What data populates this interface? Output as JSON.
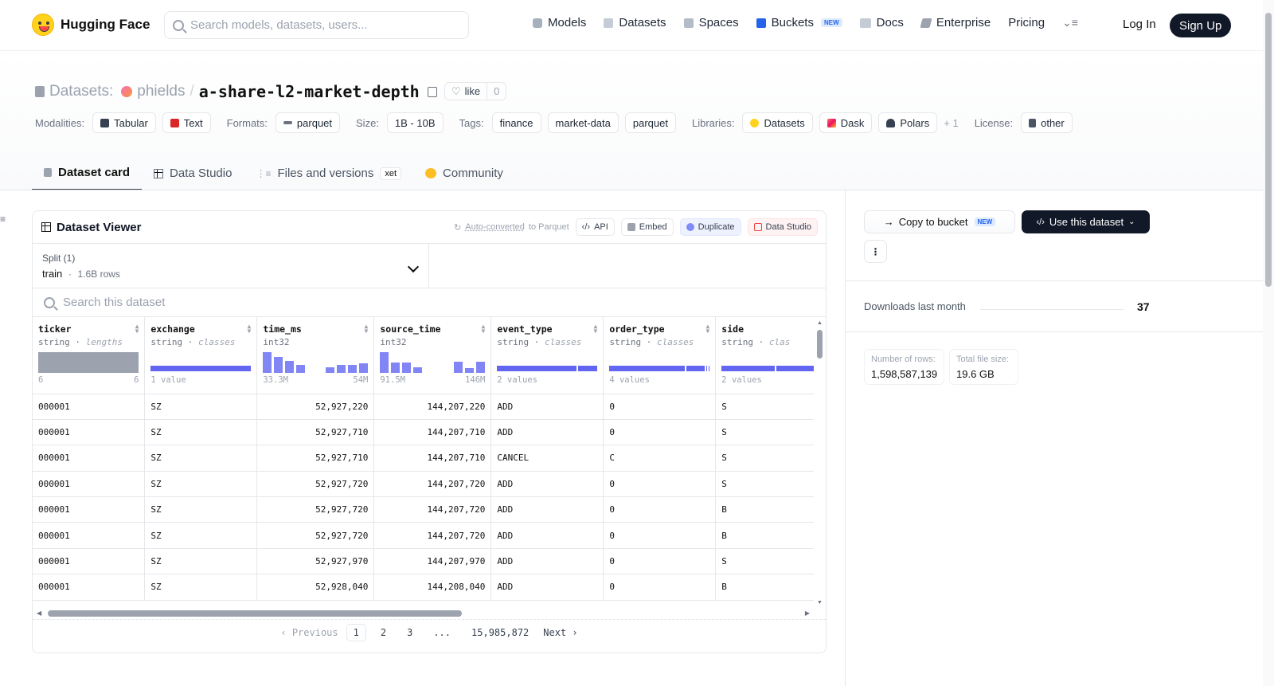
{
  "nav": {
    "brand": "Hugging Face",
    "search_placeholder": "Search models, datasets, users...",
    "links": [
      "Models",
      "Datasets",
      "Spaces",
      "Buckets",
      "Docs",
      "Enterprise",
      "Pricing"
    ],
    "new_badge": "NEW",
    "login": "Log In",
    "signup": "Sign Up"
  },
  "dataset": {
    "section_label": "Datasets:",
    "owner": "phields",
    "slash": "/",
    "name": "a-share-l2-market-depth",
    "like_label": "like",
    "like_count": "0"
  },
  "tags": {
    "modalities_key": "Modalities:",
    "modalities": [
      "Tabular",
      "Text"
    ],
    "formats_key": "Formats:",
    "formats": [
      "parquet"
    ],
    "size_key": "Size:",
    "size": "1B - 10B",
    "tags_key": "Tags:",
    "tags": [
      "finance",
      "market-data",
      "parquet"
    ],
    "libraries_key": "Libraries:",
    "libraries": [
      "Datasets",
      "Dask",
      "Polars"
    ],
    "libraries_more": "+ 1",
    "license_key": "License:",
    "license": "other"
  },
  "tabs": {
    "card": "Dataset card",
    "studio": "Data Studio",
    "files": "Files and versions",
    "xet": "xet",
    "community": "Community"
  },
  "viewer": {
    "title": "Dataset Viewer",
    "auto_converted": "Auto-converted",
    "to_parquet": "to Parquet",
    "api": "API",
    "embed": "Embed",
    "duplicate": "Duplicate",
    "data_studio": "Data Studio",
    "split_label": "Split (1)",
    "split_name": "train",
    "split_dot": "·",
    "split_rows": "1.6B rows",
    "search_placeholder": "Search this dataset",
    "columns": [
      {
        "name": "ticker",
        "type": "string",
        "stat": "lengths",
        "foot_left": "6",
        "foot_right": "6"
      },
      {
        "name": "exchange",
        "type": "string",
        "stat": "classes",
        "foot_left": "1 value",
        "foot_right": ""
      },
      {
        "name": "time_ms",
        "type": "int32",
        "stat": "",
        "foot_left": "33.3M",
        "foot_right": "54M"
      },
      {
        "name": "source_time",
        "type": "int32",
        "stat": "",
        "foot_left": "91.5M",
        "foot_right": "146M"
      },
      {
        "name": "event_type",
        "type": "string",
        "stat": "classes",
        "foot_left": "2 values",
        "foot_right": ""
      },
      {
        "name": "order_type",
        "type": "string",
        "stat": "classes",
        "foot_left": "4 values",
        "foot_right": ""
      },
      {
        "name": "side",
        "type": "string",
        "stat": "clas",
        "foot_left": "2 values",
        "foot_right": ""
      }
    ],
    "rows": [
      [
        "000001",
        "SZ",
        "52,927,220",
        "144,207,220",
        "ADD",
        "0",
        "S"
      ],
      [
        "000001",
        "SZ",
        "52,927,710",
        "144,207,710",
        "ADD",
        "0",
        "S"
      ],
      [
        "000001",
        "SZ",
        "52,927,710",
        "144,207,710",
        "CANCEL",
        "C",
        "S"
      ],
      [
        "000001",
        "SZ",
        "52,927,720",
        "144,207,720",
        "ADD",
        "0",
        "S"
      ],
      [
        "000001",
        "SZ",
        "52,927,720",
        "144,207,720",
        "ADD",
        "0",
        "B"
      ],
      [
        "000001",
        "SZ",
        "52,927,720",
        "144,207,720",
        "ADD",
        "0",
        "B"
      ],
      [
        "000001",
        "SZ",
        "52,927,970",
        "144,207,970",
        "ADD",
        "0",
        "S"
      ],
      [
        "000001",
        "SZ",
        "52,928,040",
        "144,208,040",
        "ADD",
        "0",
        "B"
      ]
    ],
    "pager": {
      "previous": "Previous",
      "pages": [
        "1",
        "2",
        "3"
      ],
      "ellipsis": "...",
      "last": "15,985,872",
      "next": "Next"
    }
  },
  "sidebar": {
    "copy_to_bucket": "Copy to bucket",
    "new_badge": "NEW",
    "use_dataset": "Use this dataset",
    "downloads_label": "Downloads last month",
    "downloads_value": "37",
    "rows_label": "Number of rows:",
    "rows_value": "1,598,587,139",
    "size_label": "Total file size:",
    "size_value": "19.6 GB"
  },
  "colors": {
    "accent": "#6366f1",
    "dark_button": "#111827",
    "hf_yellow": "#ffd21e"
  }
}
